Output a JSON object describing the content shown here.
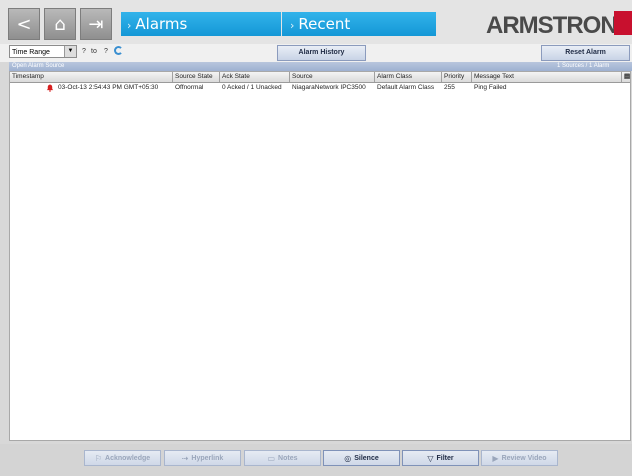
{
  "nav": {
    "back_icon": "chevron-left-icon",
    "home_icon": "home-icon",
    "exit_icon": "door-exit-icon",
    "crumb1": "Alarms",
    "crumb2": "Recent",
    "logo": "ARMSTRONG"
  },
  "toolbar": {
    "time_range": "Time Range",
    "from": "?",
    "to_label": "to",
    "to": "?",
    "alarm_history": "Alarm History",
    "reset_alarm": "Reset Alarm"
  },
  "strip": {
    "left": "Open Alarm Source",
    "right": "1 Sources / 1 Alarm"
  },
  "table": {
    "columns": [
      "Timestamp",
      "Source State",
      "Ack State",
      "Source",
      "Alarm Class",
      "Priority",
      "Message Text"
    ],
    "rows": [
      {
        "timestamp": "03-Oct-13 2:54:43 PM GMT+05:30",
        "source_state": "Offnormal",
        "ack_state": "0 Acked / 1 Unacked",
        "source": "NiagaraNetwork IPC3500",
        "alarm_class": "Default Alarm Class",
        "priority": "255",
        "message": "Ping Failed"
      }
    ]
  },
  "actions": {
    "acknowledge": "Acknowledge",
    "hyperlink": "Hyperlink",
    "notes": "Notes",
    "silence": "Silence",
    "filter": "Filter",
    "review_video": "Review Video"
  },
  "colors": {
    "accent": "#1fa3df",
    "logo_red": "#c8102e",
    "alarm_red": "#d61f1f"
  }
}
